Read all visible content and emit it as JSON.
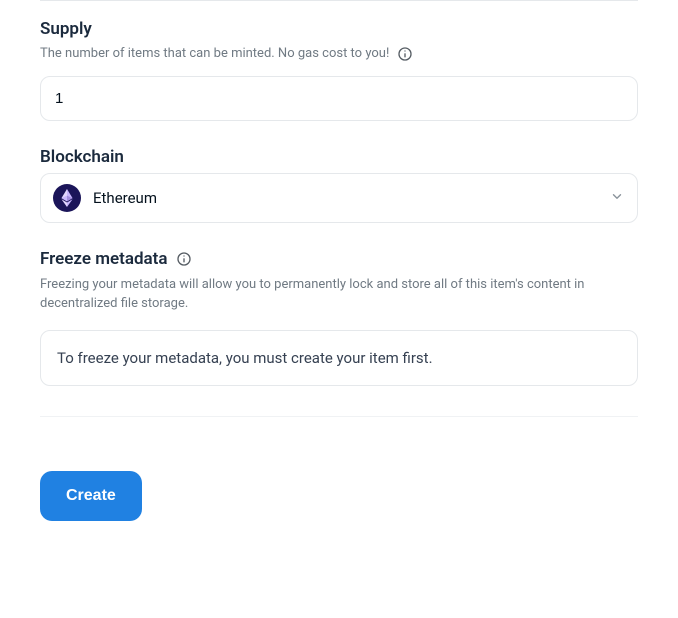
{
  "supply": {
    "label": "Supply",
    "helper": "The number of items that can be minted. No gas cost to you!",
    "value": "1"
  },
  "blockchain": {
    "label": "Blockchain",
    "selected": "Ethereum"
  },
  "freeze": {
    "label": "Freeze metadata",
    "helper": "Freezing your metadata will allow you to permanently lock and store all of this item's content in decentralized file storage.",
    "notice": "To freeze your metadata, you must create your item first."
  },
  "actions": {
    "create": "Create"
  }
}
